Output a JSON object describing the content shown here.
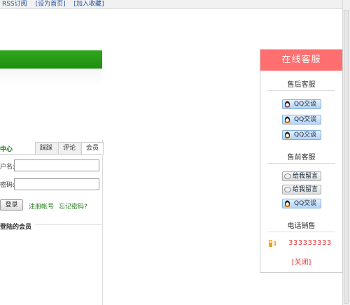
{
  "topbar": {
    "links": [
      "RSS订阅",
      "[设为首页]",
      "[加入收藏]"
    ]
  },
  "member": {
    "title": "中心",
    "tabs": [
      "踩踩",
      "评论",
      "会员"
    ],
    "username_label": "户名:",
    "password_label": "密码:",
    "username_value": "",
    "password_value": "",
    "login_label": "登录",
    "register_label": "注册帐号",
    "forgot_label": "忘记密码?",
    "online_title": "登陆的会员"
  },
  "service": {
    "title": "在线客服",
    "after_sales": "售后客服",
    "pre_sales": "售前客服",
    "phone_sales": "电话销售",
    "qq_label": "QQ交谈",
    "message_label": "给我留言",
    "phone_number": "333333333",
    "close_label": "[关闭]"
  },
  "colors": {
    "header_red": "#ff6f6f",
    "green_bar": "#2fa81d",
    "phone_red": "#e03b3b",
    "link_blue": "#1b4f9e"
  }
}
